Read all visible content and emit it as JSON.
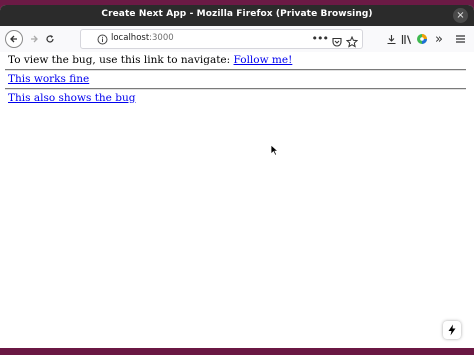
{
  "window": {
    "title": "Create Next App - Mozilla Firefox (Private Browsing)",
    "close_symbol": "×"
  },
  "toolbar": {
    "url_host": "localhost",
    "url_port": ":3000",
    "page_actions_symbol": "•••",
    "overflow_symbol": "»",
    "icons": [
      "back-icon",
      "forward-icon",
      "reload-icon",
      "info-icon",
      "page-actions-icon",
      "pocket-icon",
      "bookmark-star-icon",
      "download-icon",
      "library-icon",
      "profile-icon",
      "overflow-icon",
      "menu-icon"
    ]
  },
  "page": {
    "intro_text": "To view the bug, use this link to navigate: ",
    "follow_link": "Follow me!",
    "works_link": "This works fine",
    "bug_link": "This also shows the bug"
  },
  "colors": {
    "desktop_bg": "#7a1f50",
    "titlebar_bg": "#2b2b2b",
    "link": "#0000ee"
  }
}
